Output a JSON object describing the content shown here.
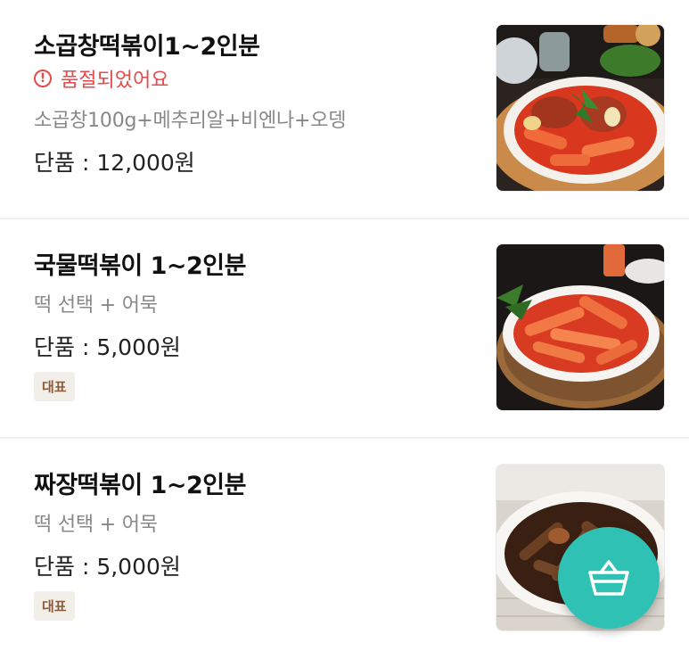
{
  "menu": [
    {
      "name": "소곱창떡볶이1~2인분",
      "soldout": "품절되었어요",
      "soldout_icon": "!",
      "description": "소곱창100g+메추리알+비엔나+오뎅",
      "price": "단품 : 12,000원",
      "image": "gopchang-tteokbokki-photo"
    },
    {
      "name": "국물떡볶이 1~2인분",
      "description": "떡 선택 + 어묵",
      "price": "단품 : 5,000원",
      "badge": "대표",
      "image": "soup-tteokbokki-photo"
    },
    {
      "name": "짜장떡볶이 1~2인분",
      "description": "떡 선택 + 어묵",
      "price": "단품 : 5,000원",
      "badge": "대표",
      "image": "jjajang-tteokbokki-photo"
    }
  ],
  "cart_button": {
    "icon": "basket-icon",
    "color": "#2fc1b3"
  },
  "colors": {
    "soldout": "#e64a4a",
    "badge_bg": "#f2efe9",
    "badge_text": "#8a5a3a"
  }
}
